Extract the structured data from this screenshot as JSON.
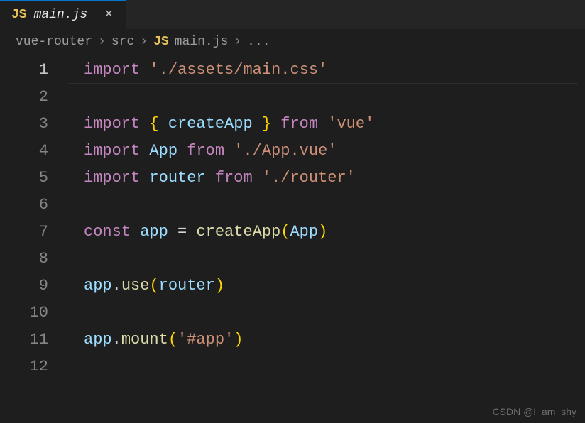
{
  "tab": {
    "icon_text": "JS",
    "label": "main.js",
    "close_glyph": "×"
  },
  "breadcrumb": {
    "items": [
      "vue-router",
      "src"
    ],
    "file_icon": "JS",
    "file": "main.js",
    "tail": "...",
    "sep": "›"
  },
  "code": {
    "active_line": 1,
    "lines": [
      {
        "n": 1,
        "tokens": [
          [
            "kw",
            "import"
          ],
          [
            "op",
            " "
          ],
          [
            "str",
            "'./assets/main.css'"
          ]
        ]
      },
      {
        "n": 2,
        "tokens": []
      },
      {
        "n": 3,
        "tokens": [
          [
            "kw",
            "import"
          ],
          [
            "op",
            " "
          ],
          [
            "brc",
            "{"
          ],
          [
            "op",
            " "
          ],
          [
            "id",
            "createApp"
          ],
          [
            "op",
            " "
          ],
          [
            "brc",
            "}"
          ],
          [
            "op",
            " "
          ],
          [
            "kw",
            "from"
          ],
          [
            "op",
            " "
          ],
          [
            "str",
            "'vue'"
          ]
        ]
      },
      {
        "n": 4,
        "tokens": [
          [
            "kw",
            "import"
          ],
          [
            "op",
            " "
          ],
          [
            "id",
            "App"
          ],
          [
            "op",
            " "
          ],
          [
            "kw",
            "from"
          ],
          [
            "op",
            " "
          ],
          [
            "str",
            "'./App.vue'"
          ]
        ]
      },
      {
        "n": 5,
        "tokens": [
          [
            "kw",
            "import"
          ],
          [
            "op",
            " "
          ],
          [
            "id",
            "router"
          ],
          [
            "op",
            " "
          ],
          [
            "kw",
            "from"
          ],
          [
            "op",
            " "
          ],
          [
            "str",
            "'./router'"
          ]
        ]
      },
      {
        "n": 6,
        "tokens": []
      },
      {
        "n": 7,
        "tokens": [
          [
            "kw",
            "const"
          ],
          [
            "op",
            " "
          ],
          [
            "id",
            "app"
          ],
          [
            "op",
            " "
          ],
          [
            "op",
            "="
          ],
          [
            "op",
            " "
          ],
          [
            "fn",
            "createApp"
          ],
          [
            "brc",
            "("
          ],
          [
            "id",
            "App"
          ],
          [
            "brc",
            ")"
          ]
        ]
      },
      {
        "n": 8,
        "tokens": []
      },
      {
        "n": 9,
        "tokens": [
          [
            "id",
            "app"
          ],
          [
            "op",
            "."
          ],
          [
            "fn",
            "use"
          ],
          [
            "brc",
            "("
          ],
          [
            "id",
            "router"
          ],
          [
            "brc",
            ")"
          ]
        ]
      },
      {
        "n": 10,
        "tokens": []
      },
      {
        "n": 11,
        "tokens": [
          [
            "id",
            "app"
          ],
          [
            "op",
            "."
          ],
          [
            "fn",
            "mount"
          ],
          [
            "brc",
            "("
          ],
          [
            "str",
            "'#app'"
          ],
          [
            "brc",
            ")"
          ]
        ]
      },
      {
        "n": 12,
        "tokens": []
      }
    ]
  },
  "watermark": "CSDN @I_am_shy"
}
